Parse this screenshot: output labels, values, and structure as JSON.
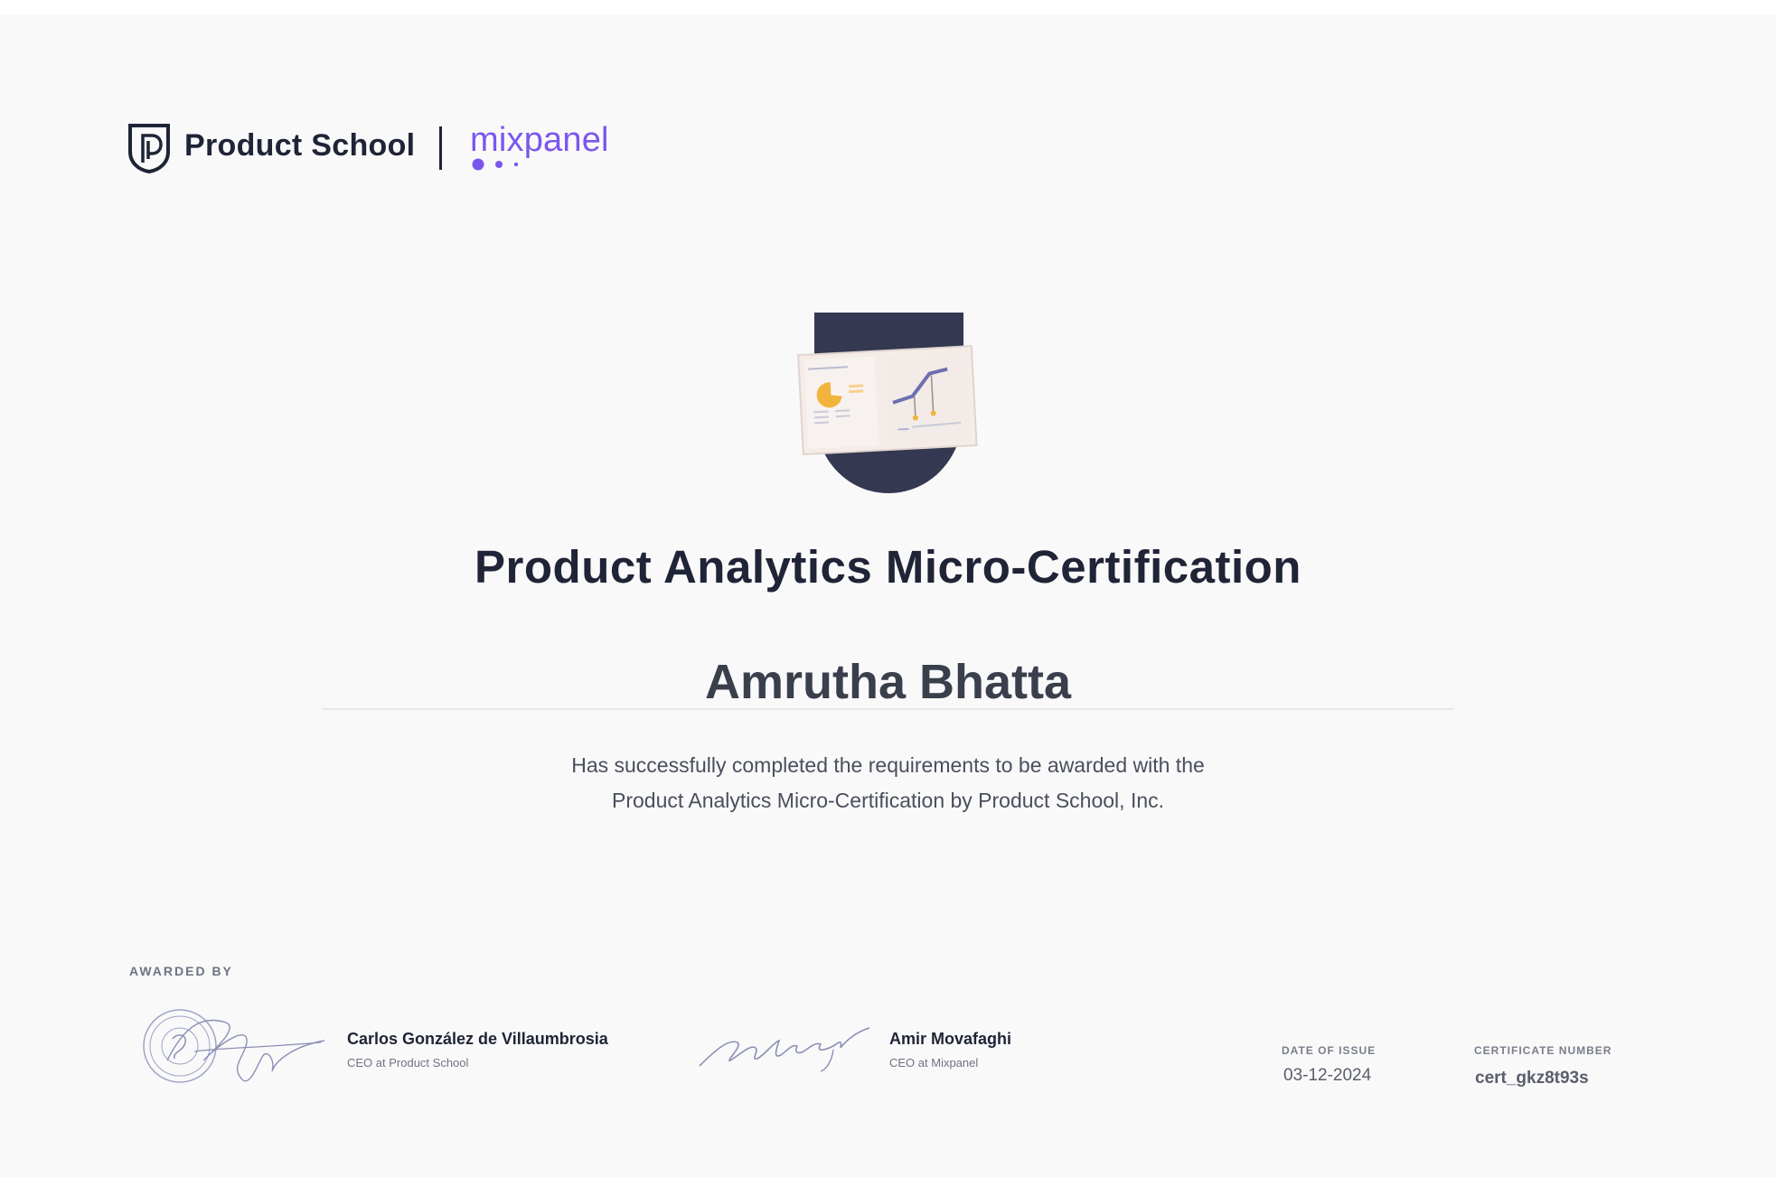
{
  "header": {
    "product_school_logo_text": "Product School",
    "mixpanel_logo_text": "mixpanel",
    "product_school_icon": "shield-p-icon",
    "mixpanel_icon": "mixpanel-dots-icon"
  },
  "badge": {
    "icon": "analytics-dashboard-badge-icon"
  },
  "certificate": {
    "title": "Product Analytics Micro-Certification",
    "recipient_name": "Amrutha Bhatta",
    "description_line1": "Has successfully completed the requirements to be awarded with the",
    "description_line2": "Product Analytics Micro-Certification by Product School, Inc."
  },
  "footer": {
    "awarded_by_label": "AWARDED BY",
    "signatories": [
      {
        "name": "Carlos González de Villaumbrosia",
        "role": "CEO at Product School"
      },
      {
        "name": "Amir Movafaghi",
        "role": "CEO at Mixpanel"
      }
    ],
    "date_of_issue_label": "DATE OF ISSUE",
    "date_of_issue": "03-12-2024",
    "certificate_number_label": "CERTIFICATE NUMBER",
    "certificate_number": "cert_gkz8t93s"
  },
  "colors": {
    "brand_dark": "#1f2436",
    "mixpanel_purple": "#7b56ee",
    "badge_navy": "#343851",
    "chart_yellow": "#f2b43c",
    "background": "#f9f9fa"
  }
}
